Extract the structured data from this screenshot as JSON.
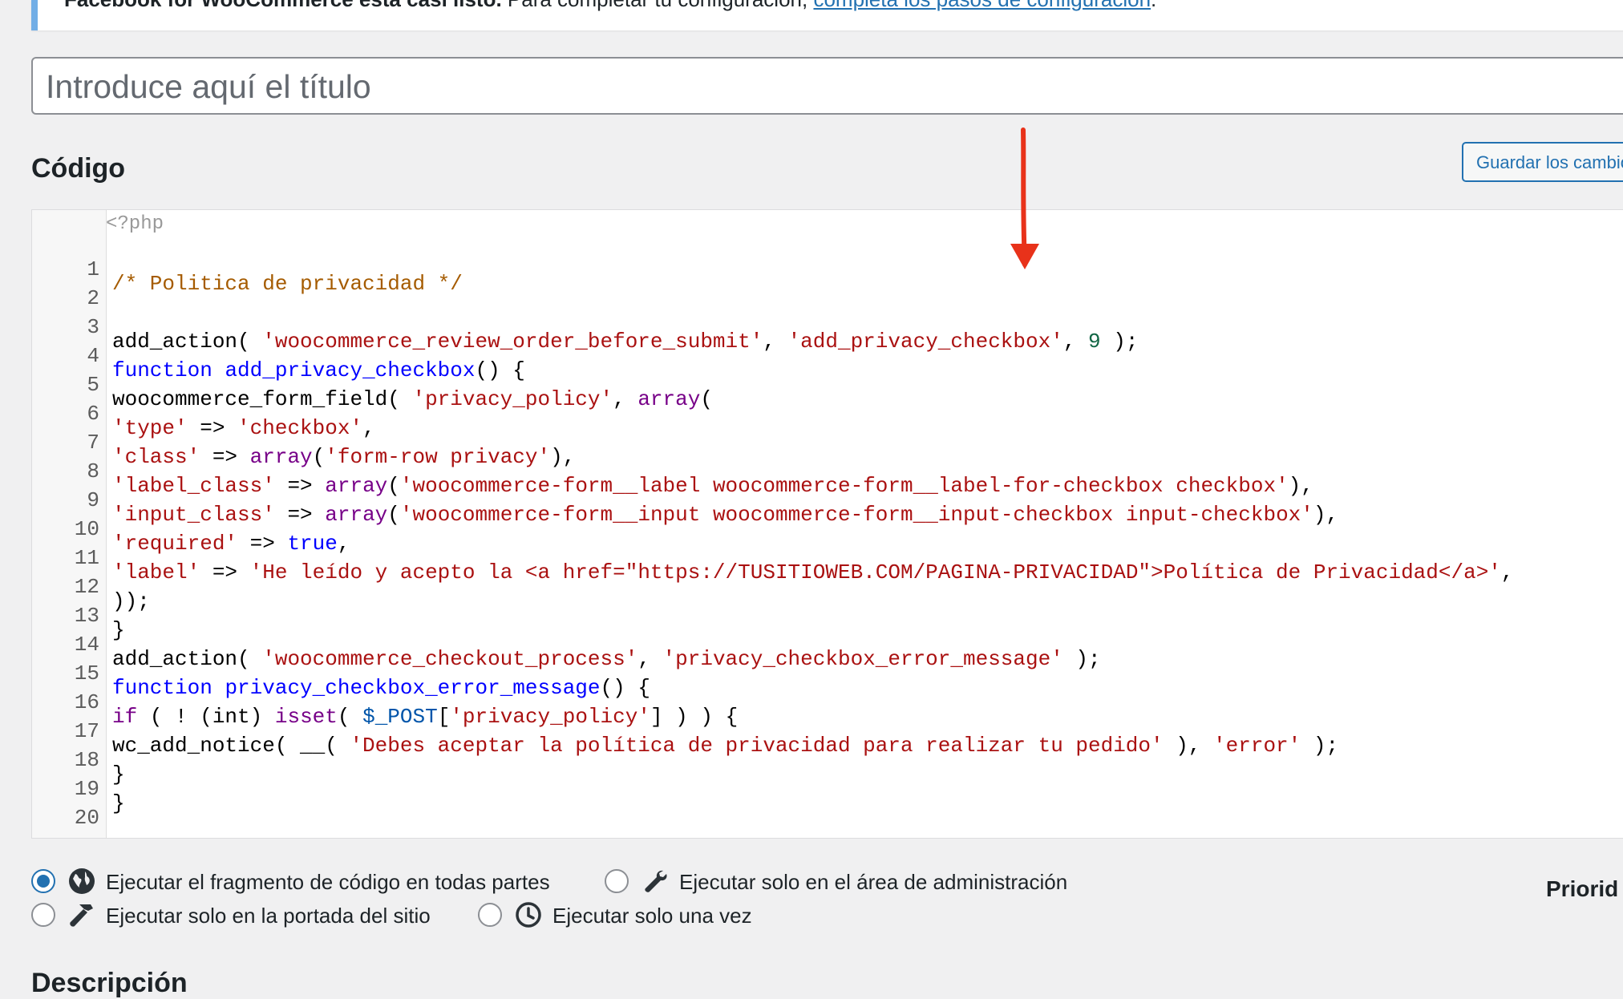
{
  "notice": {
    "bold": "Facebook for WooCommerce está casi listo.",
    "text": " Para completar tu configuración, ",
    "link": "completa los pasos de configuración",
    "tail": "."
  },
  "title_input": {
    "placeholder": "Introduce aquí el título"
  },
  "section": {
    "heading": "Código",
    "save_button": "Guardar los cambios"
  },
  "editor": {
    "php_open": "<?php",
    "lines": [
      {
        "n": "1"
      },
      {
        "n": "2"
      },
      {
        "n": "3"
      },
      {
        "n": "4"
      },
      {
        "n": "5"
      },
      {
        "n": "6"
      },
      {
        "n": "7"
      },
      {
        "n": "8"
      },
      {
        "n": "9"
      },
      {
        "n": "10"
      },
      {
        "n": "11"
      },
      {
        "n": "12"
      },
      {
        "n": "13"
      },
      {
        "n": "14"
      },
      {
        "n": "15"
      },
      {
        "n": "16"
      },
      {
        "n": "17"
      },
      {
        "n": "18"
      },
      {
        "n": "19"
      },
      {
        "n": "20"
      }
    ],
    "code": {
      "l1": "/* Politica de privacidad */",
      "l3a": "add_action( ",
      "l3b": "'woocommerce_review_order_before_submit'",
      "l3c": ", ",
      "l3d": "'add_privacy_checkbox'",
      "l3e": ", ",
      "l3f": "9",
      "l3g": " );",
      "l4a": "function",
      "l4b": " ",
      "l4c": "add_privacy_checkbox",
      "l4d": "() {",
      "l5a": "woocommerce_form_field( ",
      "l5b": "'privacy_policy'",
      "l5c": ", ",
      "l5d": "array",
      "l5e": "(",
      "l6a": "'type'",
      "l6b": " => ",
      "l6c": "'checkbox'",
      "l6d": ",",
      "l7a": "'class'",
      "l7b": " => ",
      "l7c": "array",
      "l7d": "(",
      "l7e": "'form-row privacy'",
      "l7f": "),",
      "l8a": "'label_class'",
      "l8b": " => ",
      "l8c": "array",
      "l8d": "(",
      "l8e": "'woocommerce-form__label woocommerce-form__label-for-checkbox checkbox'",
      "l8f": "),",
      "l9a": "'input_class'",
      "l9b": " => ",
      "l9c": "array",
      "l9d": "(",
      "l9e": "'woocommerce-form__input woocommerce-form__input-checkbox input-checkbox'",
      "l9f": "),",
      "l10a": "'required'",
      "l10b": " => ",
      "l10c": "true",
      "l10d": ",",
      "l11a": "'label'",
      "l11b": " => ",
      "l11c": "'He leído y acepto la <a href=\"https://TUSITIOWEB.COM/PAGINA-PRIVACIDAD\">Política de Privacidad</a>'",
      "l11d": ",",
      "l12": "));",
      "l13": "}",
      "l14a": "add_action( ",
      "l14b": "'woocommerce_checkout_process'",
      "l14c": ", ",
      "l14d": "'privacy_checkbox_error_message'",
      "l14e": " );",
      "l15a": "function",
      "l15b": " ",
      "l15c": "privacy_checkbox_error_message",
      "l15d": "() {",
      "l16a": "if",
      "l16b": " ( ! (int) ",
      "l16c": "isset",
      "l16d": "( ",
      "l16e": "$_POST",
      "l16f": "[",
      "l16g": "'privacy_policy'",
      "l16h": "] ) ) {",
      "l17a": "wc_add_notice( __( ",
      "l17b": "'Debes aceptar la política de privacidad para realizar tu pedido'",
      "l17c": " ), ",
      "l17d": "'error'",
      "l17e": " );",
      "l18": "}",
      "l19": "}"
    }
  },
  "options": {
    "everywhere": "Ejecutar el fragmento de código en todas partes",
    "admin": "Ejecutar solo en el área de administración",
    "frontend": "Ejecutar solo en la portada del sitio",
    "once": "Ejecutar solo una vez",
    "selected": "everywhere"
  },
  "priority_label": "Priorid",
  "description_heading": "Descripción",
  "colors": {
    "accent": "#2271b1",
    "annotation_arrow": "#e8321a"
  }
}
